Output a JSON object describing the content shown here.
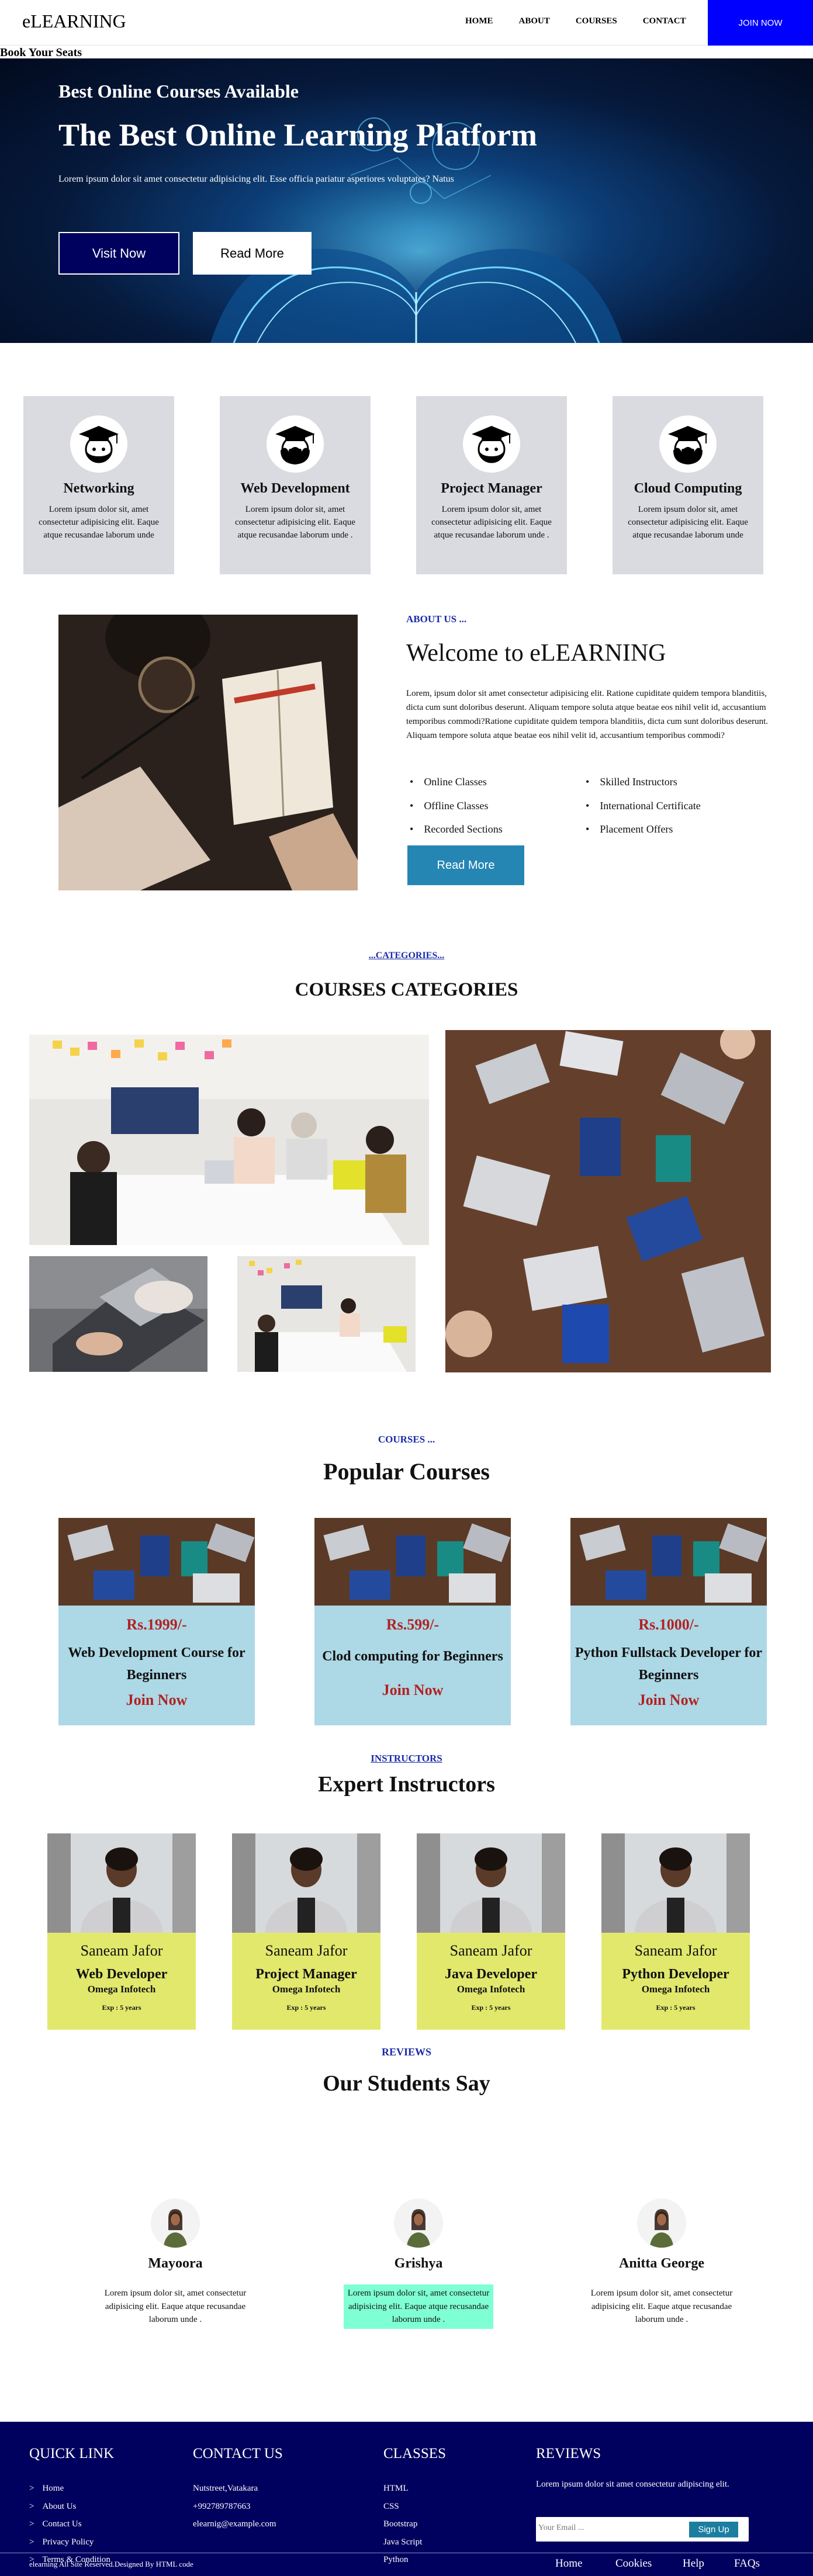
{
  "nav": {
    "brand": "eLEARNING",
    "links": [
      "HOME",
      "ABOUT",
      "COURSES",
      "CONTACT"
    ],
    "join_label": "JOIN NOW"
  },
  "book_seats": "Book Your Seats",
  "hero": {
    "subtitle": "Best Online Courses Available",
    "title": "The Best Online Learning Platform",
    "text": "Lorem ipsum dolor sit amet consectetur adipisicing elit. Esse officia pariatur asperiores voluptates? Natus",
    "btn_visit": "Visit Now",
    "btn_read": "Read More"
  },
  "services": [
    {
      "title": "Networking",
      "text": "Lorem ipsum dolor sit, amet consectetur adipisicing elit. Eaque atque recusandae laborum unde"
    },
    {
      "title": "Web Development",
      "text": "Lorem ipsum dolor sit, amet consectetur adipisicing elit. Eaque atque recusandae laborum unde ."
    },
    {
      "title": "Project Manager",
      "text": "Lorem ipsum dolor sit, amet consectetur adipisicing elit. Eaque atque recusandae laborum unde ."
    },
    {
      "title": "Cloud Computing",
      "text": "Lorem ipsum dolor sit, amet consectetur adipisicing elit. Eaque atque recusandae laborum unde"
    }
  ],
  "about": {
    "tag": "ABOUT US ...",
    "title": "Welcome to eLEARNING",
    "text": "Lorem, ipsum dolor sit amet consectetur adipisicing elit. Ratione cupiditate quidem tempora blanditiis, dicta cum sunt doloribus deserunt. Aliquam tempore soluta atque beatae eos nihil velit id, accusantium temporibus commodi?Ratione cupiditate quidem tempora blanditiis, dicta cum sunt doloribus deserunt. Aliquam tempore soluta atque beatae eos nihil velit id, accusantium temporibus commodi?",
    "list_left": [
      "Online Classes",
      "Offline Classes",
      "Recorded Sections"
    ],
    "list_right": [
      "Skilled Instructors",
      "International Certificate",
      "Placement Offers"
    ],
    "btn": "Read More"
  },
  "categories": {
    "tag": "...CATEGORIES...",
    "title": "COURSES CATEGORIES"
  },
  "popular": {
    "tag": "COURSES ...",
    "title": "Popular Courses",
    "courses": [
      {
        "price": "Rs.1999/-",
        "name": "Web Development Course for Beginners",
        "join": "Join Now"
      },
      {
        "price": "Rs.599/-",
        "name": "Clod computing for Beginners",
        "join": "Join Now"
      },
      {
        "price": "Rs.1000/-",
        "name": "Python Fullstack Developer for Beginners",
        "join": "Join Now"
      }
    ]
  },
  "instructors": {
    "tag": "INSTRUCTORS",
    "title": "Expert Instructors",
    "people": [
      {
        "name": "Saneam Jafor",
        "role": "Web Developer",
        "org": "Omega Infotech",
        "exp": "Exp : 5 years"
      },
      {
        "name": "Saneam Jafor",
        "role": "Project Manager",
        "org": "Omega Infotech",
        "exp": "Exp : 5 years"
      },
      {
        "name": "Saneam Jafor",
        "role": "Java Developer",
        "org": "Omega Infotech",
        "exp": "Exp : 5 years"
      },
      {
        "name": "Saneam Jafor",
        "role": "Python Developer",
        "org": "Omega Infotech",
        "exp": "Exp : 5 years"
      }
    ]
  },
  "reviews": {
    "tag": "REVIEWS",
    "title": "Our Students Say",
    "items": [
      {
        "name": "Mayoora",
        "text": "Lorem ipsum dolor sit, amet consectetur adipisicing elit. Eaque atque recusandae laborum unde ."
      },
      {
        "name": "Grishya",
        "text": "Lorem ipsum dolor sit, amet consectetur adipisicing elit. Eaque atque recusandae laborum unde ."
      },
      {
        "name": "Anitta George",
        "text": "Lorem ipsum dolor sit, amet consectetur adipisicing elit. Eaque atque recusandae laborum unde ."
      }
    ]
  },
  "footer": {
    "quick_title": "QUICK LINK",
    "quick_links": [
      "Home",
      "About Us",
      "Contact Us",
      "Privacy Policy",
      "Terms & Condition"
    ],
    "contact_title": "CONTACT US",
    "contact_lines": [
      "Nutstreet,Vatakara",
      "+992789787663",
      "elearnig@example.com"
    ],
    "classes_title": "CLASSES",
    "classes": [
      "HTML",
      "CSS",
      "Bootstrap",
      "Java Script",
      "Python"
    ],
    "reviews_title": "REVIEWS",
    "reviews_text": "Lorem ipsum dolor sit amet consectetur adipiscing elit.",
    "email_placeholder": "Your Email ...",
    "signup": "Sign Up",
    "copyright": "elearning All Site Reserved.Designed By HTML code",
    "bottom_links": [
      "Home",
      "Cookies",
      "Help",
      "FAQs"
    ]
  },
  "colors": {
    "accent_blue": "#0000ff",
    "navy": "#00005e",
    "teal_button": "#2586b4",
    "course_card": "#add8e6",
    "instructor_card": "#e2e86c",
    "price_red": "#b22222",
    "highlight": "#7fffd4"
  }
}
